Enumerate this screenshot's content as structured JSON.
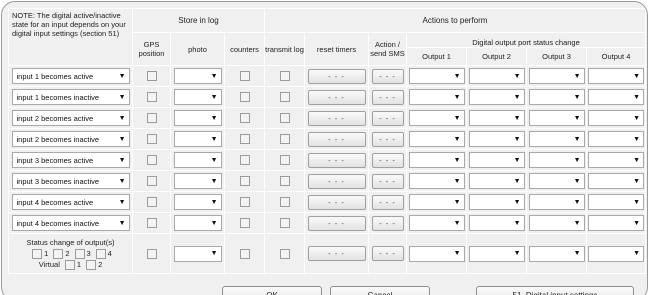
{
  "note": "NOTE: The digital active/inactive state for an input depends on your digital input settings (section 51)",
  "headers": {
    "store_in_log": "Store in log",
    "actions_to_perform": "Actions to perform",
    "gps_position": "GPS position",
    "photo": "photo",
    "counters": "counters",
    "transmit_log": "transmit log",
    "reset_timers": "reset timers",
    "action_send_sms": "Action / send SMS",
    "digital_output_status_change": "Digital output port status change",
    "outputs": [
      "Output 1",
      "Output 2",
      "Output 3",
      "Output 4"
    ]
  },
  "rows": [
    {
      "trigger": "input 1 becomes active",
      "timer_label": "- - -",
      "sms_label": "- - -"
    },
    {
      "trigger": "input 1 becomes inactive",
      "timer_label": "- - -",
      "sms_label": "- - -"
    },
    {
      "trigger": "input 2 becomes active",
      "timer_label": "- - -",
      "sms_label": "- - -"
    },
    {
      "trigger": "input 2 becomes inactive",
      "timer_label": "- - -",
      "sms_label": "- - -"
    },
    {
      "trigger": "input 3 becomes active",
      "timer_label": "- - -",
      "sms_label": "- - -"
    },
    {
      "trigger": "input 3 becomes inactive",
      "timer_label": "- - -",
      "sms_label": "- - -"
    },
    {
      "trigger": "input 4 becomes active",
      "timer_label": "- - -",
      "sms_label": "- - -"
    },
    {
      "trigger": "input 4 becomes inactive",
      "timer_label": "- - -",
      "sms_label": "- - -"
    }
  ],
  "status_change": {
    "label": "Status change of output(s)",
    "outputs": [
      "1",
      "2",
      "3",
      "4"
    ],
    "virtual_label": "Virtual",
    "virtual_outputs": [
      "1",
      "2"
    ],
    "timer_label": "- - -",
    "sms_label": "- - -"
  },
  "buttons": {
    "ok": "OK",
    "cancel": "Cancel",
    "digital_input_settings": "51. Digital input settings"
  },
  "icons": {
    "dropdown_arrow": "chevron-down-icon"
  }
}
